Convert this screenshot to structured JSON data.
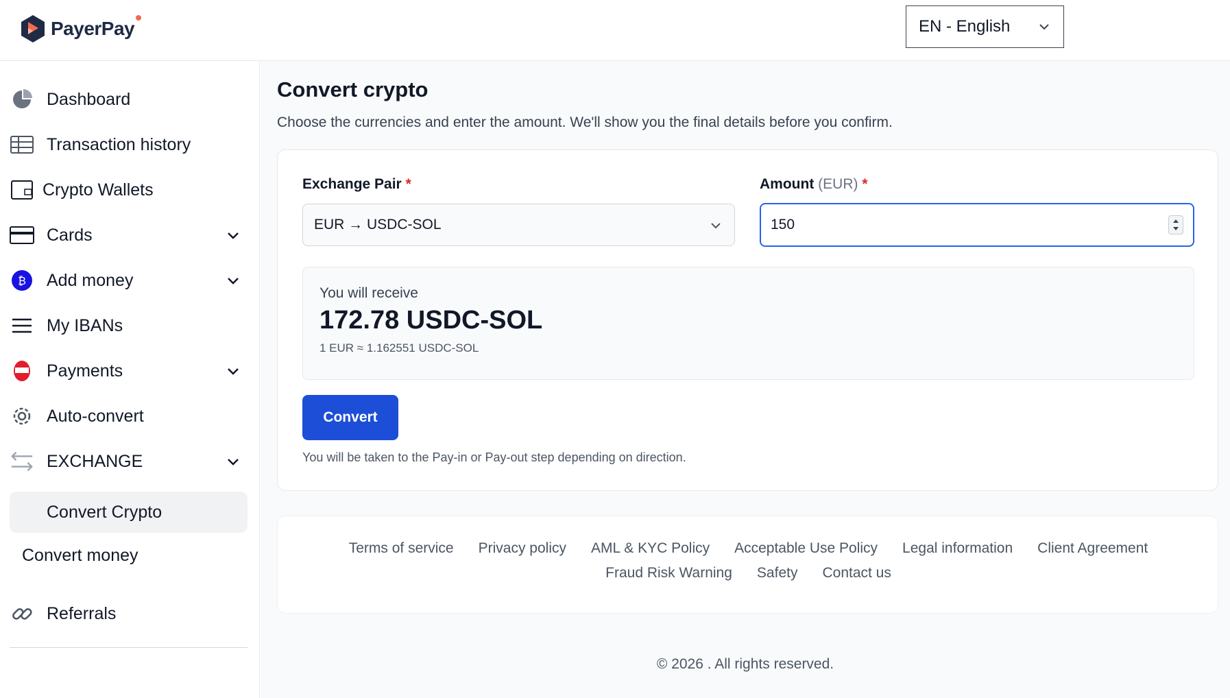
{
  "brand": {
    "name": "PayerPay"
  },
  "language": {
    "selected": "EN - English"
  },
  "sidebar": {
    "items": [
      {
        "label": "Dashboard",
        "icon": "pie-chart-icon"
      },
      {
        "label": "Transaction history",
        "icon": "table-icon"
      },
      {
        "label": "Crypto Wallets",
        "icon": "wallet-icon"
      },
      {
        "label": "Cards",
        "icon": "credit-card-icon"
      },
      {
        "label": "Add money",
        "icon": "add-money-icon"
      },
      {
        "label": "My IBANs",
        "icon": "menu-lines-icon"
      },
      {
        "label": "Payments",
        "icon": "payments-icon"
      },
      {
        "label": "Auto-convert",
        "icon": "gear-icon"
      },
      {
        "label": "EXCHANGE",
        "icon": "exchange-arrows-icon"
      }
    ],
    "exchange_sub": {
      "active": "Convert Crypto"
    },
    "convert_money": "Convert money",
    "referrals": {
      "label": "Referrals",
      "icon": "link-icon"
    }
  },
  "main": {
    "title": "Convert crypto",
    "subtitle": "Choose the currencies and enter the amount. We'll show you the final details before you confirm.",
    "form": {
      "pair_label": "Exchange Pair",
      "pair_value": "EUR → USDC-SOL",
      "amount_label": "Amount",
      "amount_currency": "(EUR)",
      "required_mark": "*",
      "amount_value": "150"
    },
    "receive": {
      "label": "You will receive",
      "amount": "172.78 USDC-SOL",
      "rate": "1 EUR ≈ 1.162551 USDC-SOL"
    },
    "convert_button": "Convert",
    "hint": "You will be taken to the Pay-in or Pay-out step depending on direction."
  },
  "footer": {
    "links_row1": [
      "Terms of service",
      "Privacy policy",
      "AML & KYC Policy",
      "Acceptable Use Policy",
      "Legal information",
      "Client Agreement"
    ],
    "links_row2": [
      "Fraud Risk Warning",
      "Safety",
      "Contact us"
    ],
    "copyright": "© 2026 . All rights reserved."
  },
  "colors": {
    "accent": "#1d4ed8",
    "focus_border": "#2563eb",
    "required": "#dc2626",
    "brand_orange": "#f26b4f",
    "brand_navy": "#1f2a44"
  }
}
